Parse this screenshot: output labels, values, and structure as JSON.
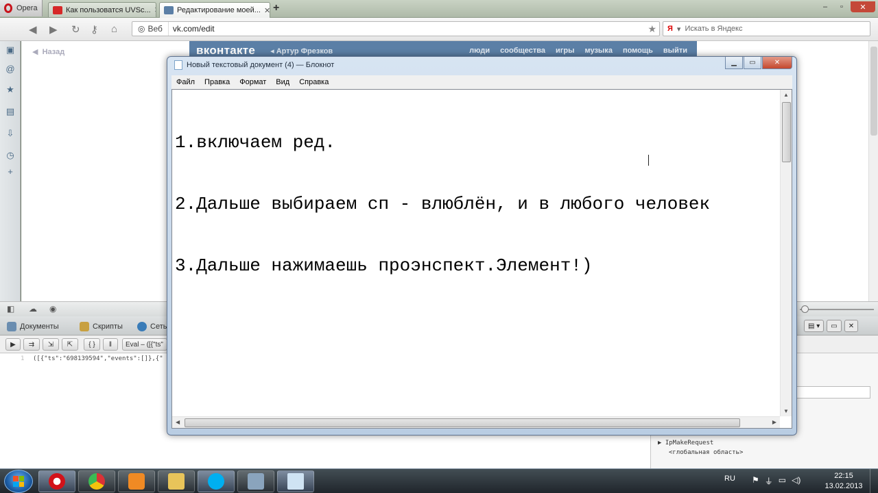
{
  "browser": {
    "menu_label": "Opera",
    "tabs": [
      {
        "label": "Как пользоватся UVSc...",
        "color": "#d62828"
      },
      {
        "label": "Редактирование моей...",
        "color": "#5b7fa6"
      }
    ],
    "address": {
      "badge": "Веб",
      "url": "vk.com/edit"
    },
    "search_placeholder": "Искать в Яндекс",
    "back_label": "Назад",
    "sidebar_icons": [
      "speed-dial-icon",
      "mail-icon",
      "bookmarks-icon",
      "notes-icon",
      "downloads-icon",
      "history-icon",
      "add-panel-icon"
    ]
  },
  "vk": {
    "logo": "вконтакте",
    "user": "Артур Фрезков",
    "nav": [
      "люди",
      "сообщества",
      "игры",
      "музыка",
      "помощь",
      "выйти"
    ]
  },
  "devtools": {
    "tabs": [
      "Документы",
      "Скрипты",
      "Сеть"
    ],
    "eval_label": "Eval – ([{\"ts\"",
    "code_line": "([{\"ts\":\"698139594\",\"events\":[]},{\"",
    "callstack": [
      "IpMakeRequest",
      "<глобальная область>"
    ]
  },
  "notepad": {
    "title": "Новый текстовый документ (4) — Блокнот",
    "menu": [
      "Файл",
      "Правка",
      "Формат",
      "Вид",
      "Справка"
    ],
    "lines": [
      "1.включаем ред.",
      "2.Дальше выбираем сп - влюблён, и в любого человек",
      "3.Дальше нажимаешь проэнспект.Элемент!)"
    ]
  },
  "taskbar": {
    "apps": [
      "opera",
      "chrome",
      "media-player",
      "explorer",
      "skype",
      "control-panel",
      "notepad"
    ],
    "language": "RU",
    "time": "22:15",
    "date": "13.02.2013"
  }
}
